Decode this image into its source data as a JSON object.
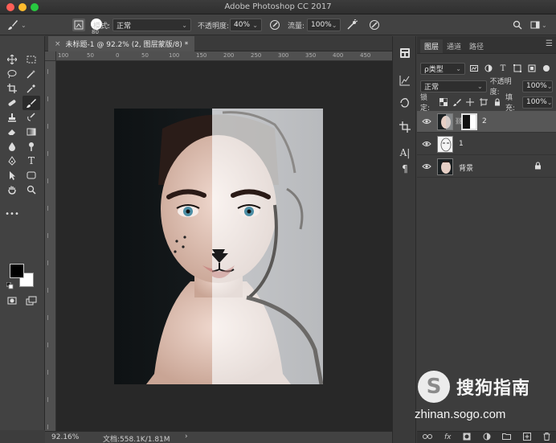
{
  "titlebar": {
    "app_title": "Adobe Photoshop CC 2017"
  },
  "optionsbar": {
    "brush_size": "80",
    "mode_label": "模式:",
    "mode_value": "正常",
    "opacity_label": "不透明度:",
    "opacity_value": "40%",
    "flow_label": "流量:",
    "flow_value": "100%"
  },
  "document": {
    "tab_title": "未标题-1 @ 92.2% (2, 图层蒙版/8) *",
    "close_glyph": "×"
  },
  "ruler": {
    "h_ticks": [
      "100",
      "50",
      "0",
      "50",
      "100",
      "150",
      "200",
      "250",
      "300",
      "350",
      "400",
      "450"
    ]
  },
  "statusbar": {
    "zoom": "92.16%",
    "doc_info": "文档:558.1K/1.81M",
    "arrow": "›"
  },
  "layers_panel": {
    "tabs": [
      "图层",
      "通道",
      "路径"
    ],
    "filter_kind": "ρ类型",
    "blend_mode": "正常",
    "opacity_label": "不透明度:",
    "opacity_value": "100%",
    "lock_label": "锁定:",
    "fill_label": "填充:",
    "fill_value": "100%",
    "layers": [
      {
        "name": "2",
        "selected": true
      },
      {
        "name": "1",
        "selected": false
      },
      {
        "name": "背景",
        "selected": false
      }
    ],
    "footer_icons": [
      "link-icon",
      "fx-icon",
      "mask-icon",
      "adjustment-icon",
      "group-icon",
      "new-layer-icon",
      "trash-icon"
    ],
    "footer_fx": "fx"
  },
  "watermark": {
    "logo_glyph": "S",
    "brand": "搜狗指南",
    "url": "zhinan.sogo.com"
  },
  "colors": {
    "foreground": "#000000",
    "background": "#ffffff",
    "selected_layer": "#575757"
  }
}
